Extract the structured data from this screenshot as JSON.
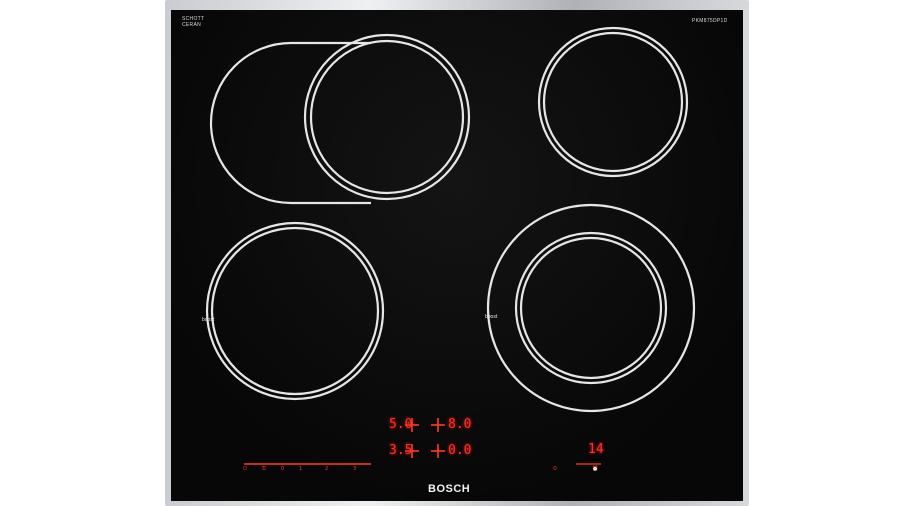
{
  "hob": {
    "manufacturer_label": [
      "SCHOTT",
      "CERAN"
    ],
    "model_number": "PKM875DP1D",
    "brand": "BOSCH",
    "boost_label": "boost",
    "displays": {
      "top_left": "5.0",
      "top_right": "8.0",
      "bottom_left": "3.5",
      "bottom_right": "0.0",
      "timer": "14"
    },
    "slider_digits": [
      "0",
      "1",
      "2",
      "3",
      "4",
      "5",
      "6",
      "7",
      "8",
      "9"
    ],
    "colors": {
      "glass": "#070707",
      "ring": "#e6e6e6",
      "led": "#ff3028",
      "frame": "#c9ccd0"
    },
    "icons": [
      "power-icon",
      "lock-icon",
      "timer-icon",
      "alarm-icon"
    ]
  }
}
